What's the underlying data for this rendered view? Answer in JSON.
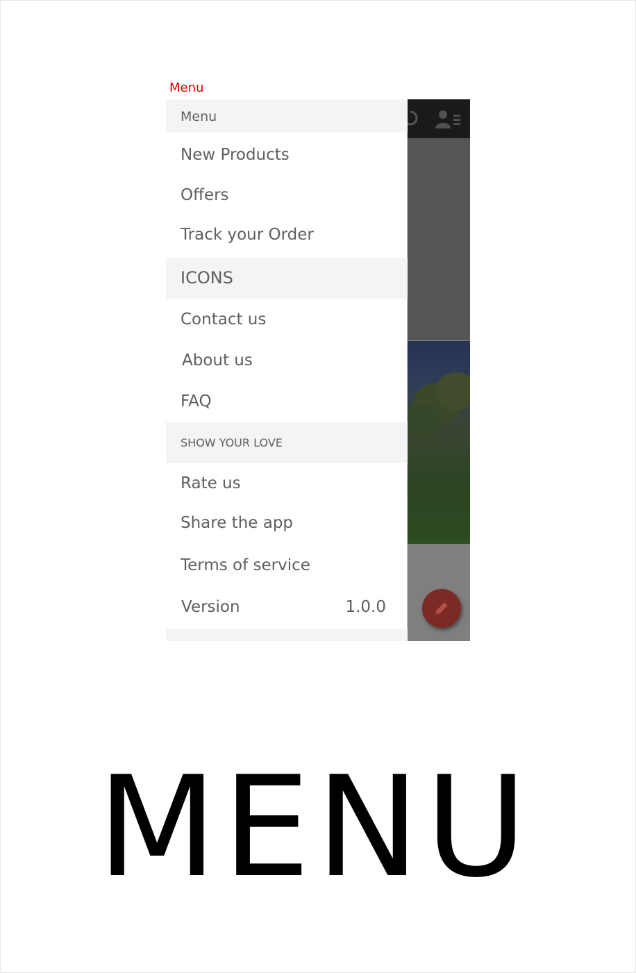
{
  "caption_top": "Menu",
  "big_title": "MENU",
  "drawer": {
    "header": "Menu",
    "items": [
      {
        "label": "New Products"
      },
      {
        "label": "Offers"
      },
      {
        "label": "Track your Order"
      }
    ],
    "icons_section": "ICONS",
    "info_items": [
      {
        "label": "Contact us"
      },
      {
        "label": "About us"
      },
      {
        "label": "FAQ"
      }
    ],
    "love_section": "SHOW YOUR LOVE",
    "love_items": [
      {
        "label": "Rate us"
      },
      {
        "label": "Share the app"
      },
      {
        "label": "Terms of service"
      }
    ],
    "version_label": "Version",
    "version_value": "1.0.0"
  },
  "colors": {
    "caption": "#e00000",
    "fab": "#7c2a26",
    "drawer_text": "#5f5f5f",
    "section_bg": "#f4f4f4"
  },
  "icons": {
    "header_left": "refresh-icon",
    "header_right": "user-list-icon",
    "fab": "pencil-icon"
  }
}
